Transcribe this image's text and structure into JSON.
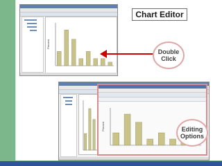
{
  "slide": {
    "title": "Chart Editor",
    "callout_1": {
      "line1": "Double",
      "line2": "Click"
    },
    "callout_2": {
      "line1": "Editing",
      "line2": "Options"
    }
  },
  "colors": {
    "accent_green": "#7bb78a",
    "bar_fill": "#c9c38a",
    "arrow_red": "#cc0000",
    "oval_border": "#e0a7a7",
    "bottom_bar": "#2f5597"
  },
  "chart_data": {
    "type": "bar",
    "categories": [
      "1",
      "2",
      "3",
      "4",
      "5",
      "6",
      "7",
      "8"
    ],
    "values": [
      20,
      50,
      37,
      10,
      20,
      10,
      10,
      5
    ],
    "ylabel": "Percent",
    "ylim": [
      0,
      60
    ]
  }
}
